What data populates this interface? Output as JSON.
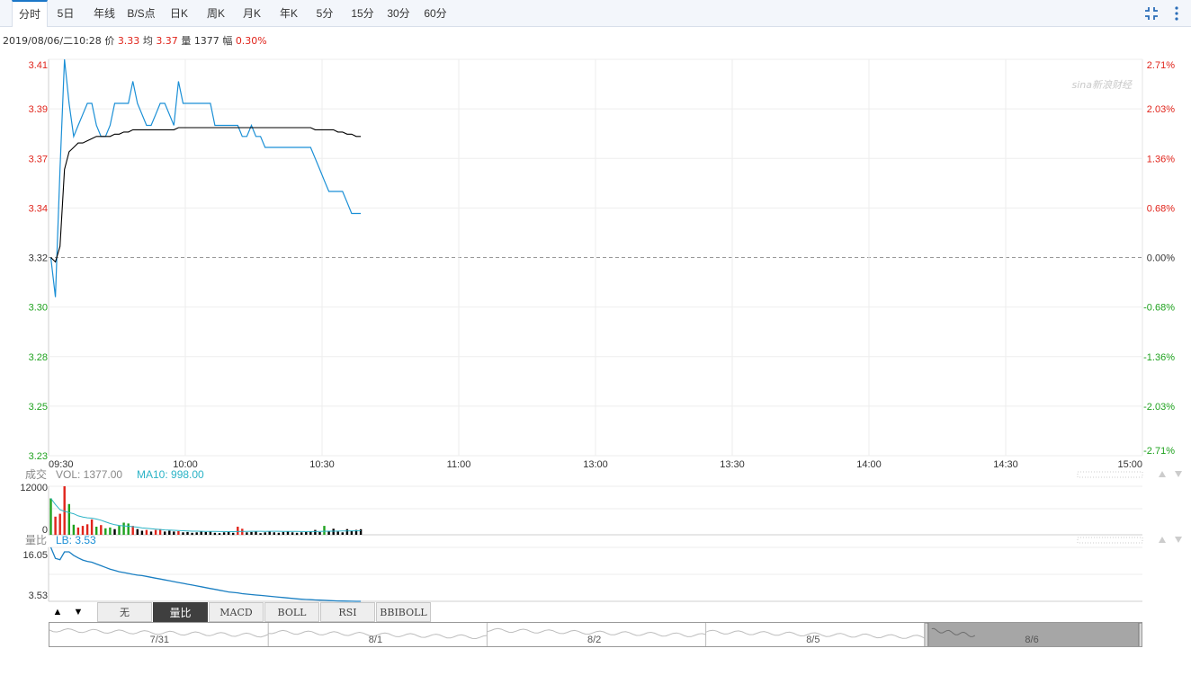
{
  "toolbar": {
    "tabs": [
      {
        "label": "分时",
        "active": true
      },
      {
        "label": "5日"
      },
      {
        "label": "年线"
      },
      {
        "label": "B/S点"
      },
      {
        "label": "日K"
      },
      {
        "label": "周K"
      },
      {
        "label": "月K"
      },
      {
        "label": "年K"
      },
      {
        "label": "5分"
      },
      {
        "label": "15分"
      },
      {
        "label": "30分"
      },
      {
        "label": "60分"
      }
    ],
    "icons": [
      "fullscreen-shrink-icon",
      "more-vertical-icon"
    ]
  },
  "info": {
    "datetime": "2019/08/06/二10:28",
    "price_label": "价",
    "price": "3.33",
    "avg_label": "均",
    "avg": "3.37",
    "vol_label": "量",
    "vol": "1377",
    "change_label": "幅",
    "change": "0.30%"
  },
  "watermark": "sina新浪财经",
  "colors": {
    "up": "#e0241b",
    "down": "#1fa21f",
    "price_line": "#1a8fd6",
    "avg_line": "#000000",
    "ma_line": "#2bb3c6"
  },
  "chart_data": [
    {
      "type": "line",
      "name": "intraday",
      "y_ticks_left": [
        "3.41",
        "3.39",
        "3.37",
        "3.34",
        "3.32",
        "3.30",
        "3.28",
        "3.25",
        "3.23"
      ],
      "y_ticks_right": [
        "2.71%",
        "2.03%",
        "1.36%",
        "0.68%",
        "0.00%",
        "-0.68%",
        "-1.36%",
        "-2.03%",
        "-2.71%"
      ],
      "x_ticks": [
        "09:30",
        "10:00",
        "10:30",
        "11:00",
        "13:00",
        "13:30",
        "14:00",
        "14:30",
        "15:00"
      ],
      "ylim": [
        3.23,
        3.41
      ],
      "baseline": 3.32,
      "series": [
        {
          "key": "price",
          "values": [
            3.32,
            3.302,
            3.36,
            3.41,
            3.39,
            3.375,
            3.38,
            3.385,
            3.39,
            3.39,
            3.38,
            3.375,
            3.375,
            3.38,
            3.39,
            3.39,
            3.39,
            3.39,
            3.4,
            3.39,
            3.385,
            3.38,
            3.38,
            3.385,
            3.39,
            3.39,
            3.385,
            3.38,
            3.4,
            3.39,
            3.39,
            3.39,
            3.39,
            3.39,
            3.39,
            3.39,
            3.38,
            3.38,
            3.38,
            3.38,
            3.38,
            3.38,
            3.375,
            3.375,
            3.38,
            3.375,
            3.375,
            3.37,
            3.37,
            3.37,
            3.37,
            3.37,
            3.37,
            3.37,
            3.37,
            3.37,
            3.37,
            3.37,
            3.365,
            3.36,
            3.355,
            3.35,
            3.35,
            3.35,
            3.35,
            3.345,
            3.34,
            3.34,
            3.34
          ]
        },
        {
          "key": "avg",
          "values": [
            3.32,
            3.318,
            3.325,
            3.36,
            3.368,
            3.37,
            3.372,
            3.372,
            3.373,
            3.374,
            3.375,
            3.375,
            3.375,
            3.375,
            3.376,
            3.376,
            3.377,
            3.377,
            3.378,
            3.378,
            3.378,
            3.378,
            3.378,
            3.378,
            3.378,
            3.378,
            3.378,
            3.378,
            3.379,
            3.379,
            3.379,
            3.379,
            3.379,
            3.379,
            3.379,
            3.379,
            3.379,
            3.379,
            3.379,
            3.379,
            3.379,
            3.379,
            3.379,
            3.379,
            3.379,
            3.379,
            3.379,
            3.379,
            3.379,
            3.379,
            3.379,
            3.379,
            3.379,
            3.379,
            3.379,
            3.379,
            3.379,
            3.379,
            3.378,
            3.378,
            3.378,
            3.378,
            3.378,
            3.377,
            3.377,
            3.376,
            3.376,
            3.375,
            3.375
          ]
        }
      ]
    },
    {
      "type": "bar",
      "name": "volume",
      "title": "成交",
      "vol_label": "VOL: 1377.00",
      "ma_label": "MA10: 998.00",
      "y_ticks": [
        "12000",
        "0"
      ],
      "ylim": [
        0,
        12000
      ],
      "values": [
        9000,
        4500,
        5200,
        13500,
        7600,
        2500,
        1800,
        2200,
        2600,
        3800,
        2000,
        2400,
        1600,
        1800,
        1400,
        2200,
        3000,
        2800,
        2200,
        1400,
        1000,
        1200,
        800,
        1200,
        1400,
        800,
        1000,
        800,
        900,
        600,
        700,
        500,
        600,
        800,
        700,
        900,
        500,
        400,
        600,
        700,
        500,
        2000,
        1500,
        600,
        700,
        800,
        400,
        600,
        900,
        600,
        500,
        700,
        800,
        600,
        500,
        600,
        700,
        800,
        1200,
        700,
        2200,
        1000,
        1500,
        800,
        600,
        1400,
        900,
        1200,
        1377
      ],
      "directions": [
        "d",
        "u",
        "u",
        "u",
        "d",
        "d",
        "u",
        "u",
        "u",
        "u",
        "d",
        "u",
        "d",
        "d",
        "d",
        "d",
        "d",
        "d",
        "u",
        "d",
        "d",
        "u",
        "d",
        "u",
        "u",
        "d",
        "d",
        "d",
        "u",
        "d",
        "d",
        "d",
        "d",
        "d",
        "d",
        "d",
        "d",
        "d",
        "d",
        "d",
        "d",
        "u",
        "u",
        "d",
        "d",
        "d",
        "d",
        "d",
        "d",
        "d",
        "d",
        "d",
        "d",
        "d",
        "d",
        "d",
        "d",
        "d",
        "d",
        "d",
        "d",
        "d",
        "d",
        "d",
        "d",
        "d",
        "d",
        "d",
        "d"
      ],
      "ma10": [
        9000,
        7500,
        6200,
        5800,
        5500,
        5200,
        4700,
        4400,
        4200,
        4100,
        3900,
        3600,
        3200,
        2800,
        2500,
        2300,
        2200,
        2100,
        2000,
        1900,
        1700,
        1600,
        1500,
        1400,
        1300,
        1200,
        1150,
        1100,
        1050,
        1000,
        950,
        900,
        880,
        860,
        840,
        830,
        820,
        800,
        790,
        780,
        780,
        800,
        830,
        850,
        860,
        870,
        860,
        850,
        860,
        870,
        860,
        850,
        840,
        830,
        820,
        810,
        800,
        800,
        810,
        820,
        860,
        880,
        900,
        920,
        940,
        960,
        970,
        985,
        998
      ]
    },
    {
      "type": "line",
      "name": "volume-ratio",
      "title": "量比",
      "lb_label": "LB: 3.53",
      "y_ticks": [
        "16.05",
        "3.53"
      ],
      "ylim": [
        3.53,
        16.05
      ],
      "values": [
        16.05,
        13.5,
        13.2,
        15.0,
        15.0,
        14.2,
        13.6,
        13.1,
        12.8,
        12.6,
        12.2,
        11.8,
        11.4,
        11.0,
        10.7,
        10.4,
        10.2,
        10.0,
        9.8,
        9.6,
        9.5,
        9.3,
        9.1,
        8.9,
        8.7,
        8.5,
        8.3,
        8.1,
        7.9,
        7.7,
        7.5,
        7.3,
        7.1,
        6.9,
        6.7,
        6.5,
        6.3,
        6.1,
        5.9,
        5.7,
        5.6,
        5.5,
        5.3,
        5.2,
        5.1,
        5.0,
        4.9,
        4.8,
        4.7,
        4.6,
        4.5,
        4.4,
        4.3,
        4.2,
        4.1,
        4.0,
        3.95,
        3.9,
        3.85,
        3.8,
        3.75,
        3.7,
        3.65,
        3.62,
        3.6,
        3.58,
        3.56,
        3.54,
        3.53
      ]
    }
  ],
  "indicators": {
    "tabs": [
      {
        "label": "无"
      },
      {
        "label": "量比",
        "active": true
      },
      {
        "label": "MACD"
      },
      {
        "label": "BOLL"
      },
      {
        "label": "RSI"
      },
      {
        "label": "BBIBOLL"
      }
    ],
    "up_arrow": "▲",
    "down_arrow": "▼"
  },
  "navigator": {
    "days": [
      "7/31",
      "8/1",
      "8/2",
      "8/5",
      "8/6"
    ],
    "selected": "8/6"
  }
}
